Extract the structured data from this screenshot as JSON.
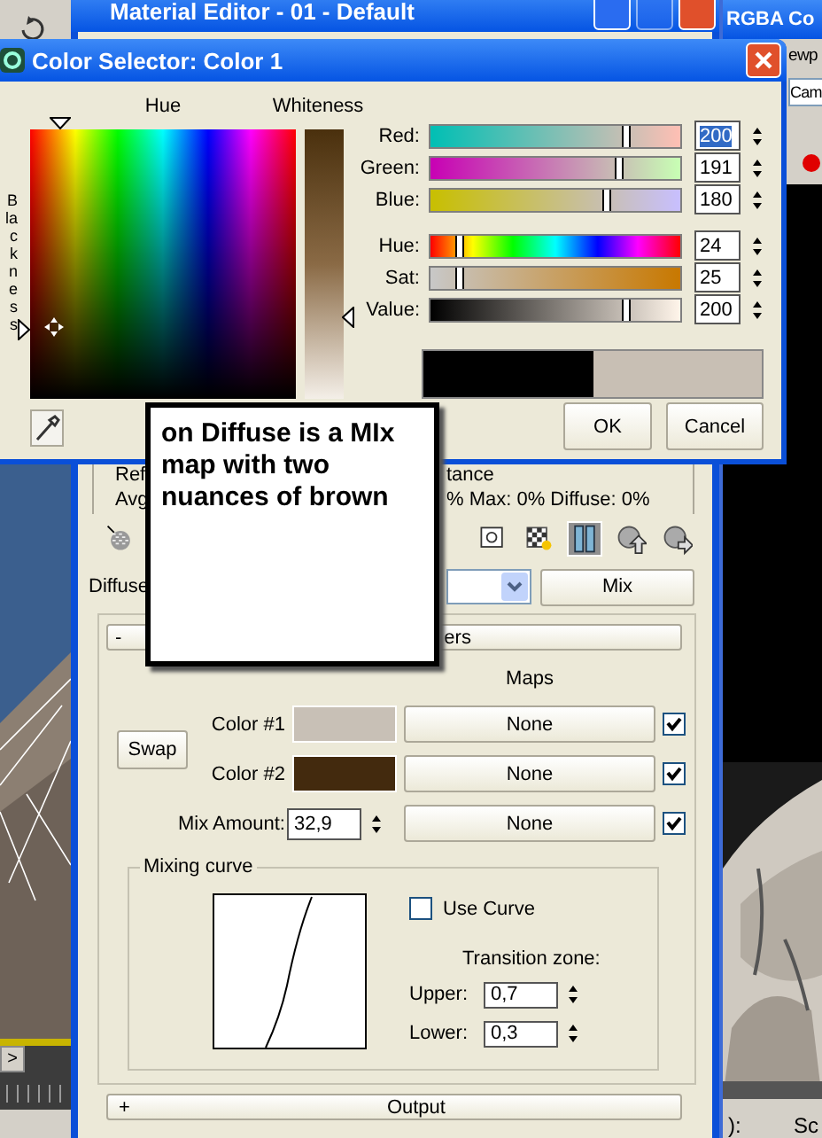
{
  "desktop": {
    "render_window": {
      "title": "RGBA Co",
      "menu": "ewp",
      "field": "Cam",
      "labels": [
        "):",
        "Sc"
      ]
    },
    "timeline_button": ">"
  },
  "material_editor": {
    "title": "Material Editor - 01 - Default",
    "reflect_left": "Ref",
    "reflect_right": "tance",
    "avg_left": "Avg",
    "stats": "% Max:  0%  Diffuse:  0%",
    "toolbar": [
      {
        "kind": "sphere_in",
        "selected": false
      },
      {
        "kind": "box",
        "selected": false
      },
      {
        "kind": "checker",
        "selected": false
      },
      {
        "kind": "bars",
        "selected": true
      },
      {
        "kind": "sphere_up",
        "selected": false
      },
      {
        "kind": "sphere_right",
        "selected": false
      }
    ],
    "map_label": "Diffuse",
    "map_type": "Mix",
    "rollout": {
      "toggle": "-",
      "title": "ers"
    },
    "maps_heading": "Maps",
    "swap": "Swap",
    "color_rows": [
      {
        "label": "Color #1",
        "color": "#c8c0b6",
        "map": "None",
        "checked": true
      },
      {
        "label": "Color #2",
        "color": "#432a0e",
        "map": "None",
        "checked": true
      }
    ],
    "mix_amount": {
      "label": "Mix Amount:",
      "value": "32,9",
      "map": "None",
      "checked": true
    },
    "mixing_curve": {
      "title": "Mixing curve",
      "use_curve": {
        "label": "Use Curve",
        "checked": false
      },
      "transition_label": "Transition zone:",
      "fields": [
        {
          "label": "Upper:",
          "value": "0,7"
        },
        {
          "label": "Lower:",
          "value": "0,3"
        }
      ]
    },
    "output_rollout": {
      "toggle": "+",
      "title": "Output"
    }
  },
  "color_selector": {
    "title": "Color Selector: Color 1",
    "hue_label": "Hue",
    "whiteness_label": "Whiteness",
    "blackness_label": "Blackness",
    "sliders": [
      {
        "kind": "red",
        "label": "Red:",
        "value": "200",
        "level": 0.78,
        "selected": true
      },
      {
        "kind": "green",
        "label": "Green:",
        "value": "191",
        "level": 0.75,
        "selected": false
      },
      {
        "kind": "blue",
        "label": "Blue:",
        "value": "180",
        "level": 0.7,
        "selected": false
      },
      {
        "kind": "hue",
        "label": "Hue:",
        "value": "24",
        "level": 0.11,
        "selected": false
      },
      {
        "kind": "sat",
        "label": "Sat:",
        "value": "25",
        "level": 0.11,
        "selected": false
      },
      {
        "kind": "value",
        "label": "Value:",
        "value": "200",
        "level": 0.78,
        "selected": false
      }
    ],
    "buttons": [
      {
        "label": "OK"
      },
      {
        "label": "Cancel"
      }
    ]
  },
  "callout": {
    "text": "on Diffuse is a MIx map with two nuances of brown"
  }
}
